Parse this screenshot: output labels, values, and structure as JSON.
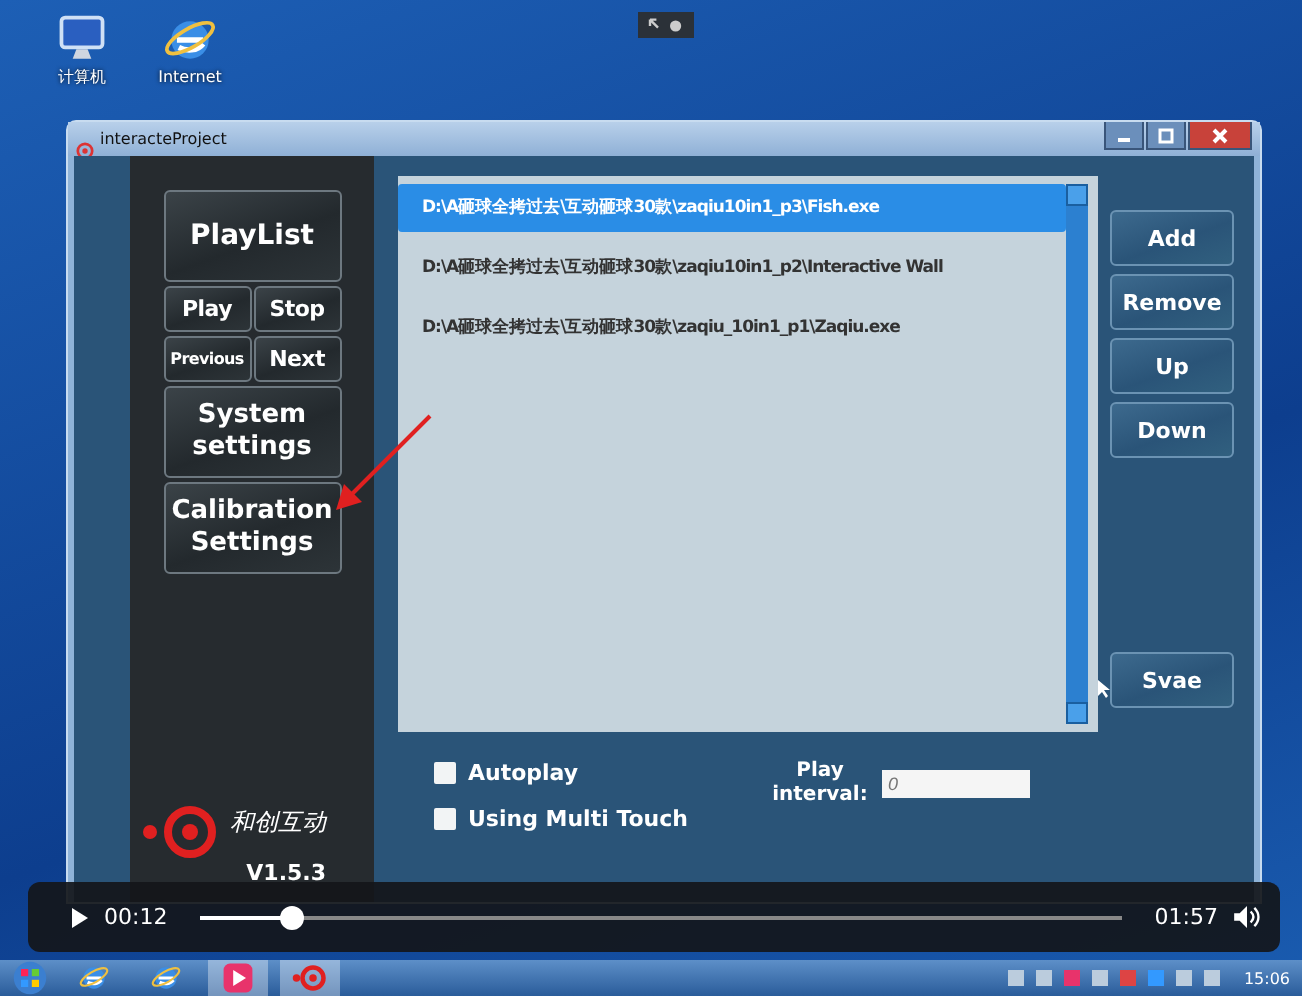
{
  "desktop_icons": [
    {
      "kind": "computer",
      "label": "计算机"
    },
    {
      "kind": "browser",
      "label": "Internet"
    }
  ],
  "window": {
    "title": "interacteProject"
  },
  "sidebar": {
    "buttons": [
      {
        "kind": "big",
        "label": "PlayList"
      },
      {
        "kind": "pair",
        "labels": [
          "Play",
          "Stop"
        ]
      },
      {
        "kind": "pair",
        "labels": [
          "Previous",
          "Next"
        ]
      },
      {
        "kind": "big",
        "label": "System settings"
      },
      {
        "kind": "big",
        "label": "Calibration Settings"
      }
    ],
    "logo": {
      "name": "和创互动",
      "version": "V1.5.3"
    }
  },
  "playlist": [
    {
      "path": "D:\\A砸球全拷过去\\互动砸球30款\\zaqiu10in1_p3\\Fish.exe",
      "selected": true
    },
    {
      "path": "D:\\A砸球全拷过去\\互动砸球30款\\zaqiu10in1_p2\\Interactive Wall",
      "selected": false
    },
    {
      "path": "D:\\A砸球全拷过去\\互动砸球30款\\zaqiu_10in1_p1\\Zaqiu.exe",
      "selected": false
    }
  ],
  "side_buttons": [
    {
      "kind": "top",
      "label": "Add"
    },
    {
      "kind": "top",
      "label": "Remove"
    },
    {
      "kind": "top",
      "label": "Up"
    },
    {
      "kind": "top",
      "label": "Down"
    },
    {
      "kind": "bottom",
      "label": "Svae"
    }
  ],
  "options": [
    {
      "label": "Autoplay",
      "checked": false
    },
    {
      "label": "Using Multi Touch",
      "checked": false
    }
  ],
  "interval": {
    "label": "Play interval:",
    "placeholder": "0"
  },
  "player": {
    "current": "00:12",
    "total": "01:57",
    "level": 0.1
  },
  "taskbar": {
    "clock": "15:06"
  }
}
